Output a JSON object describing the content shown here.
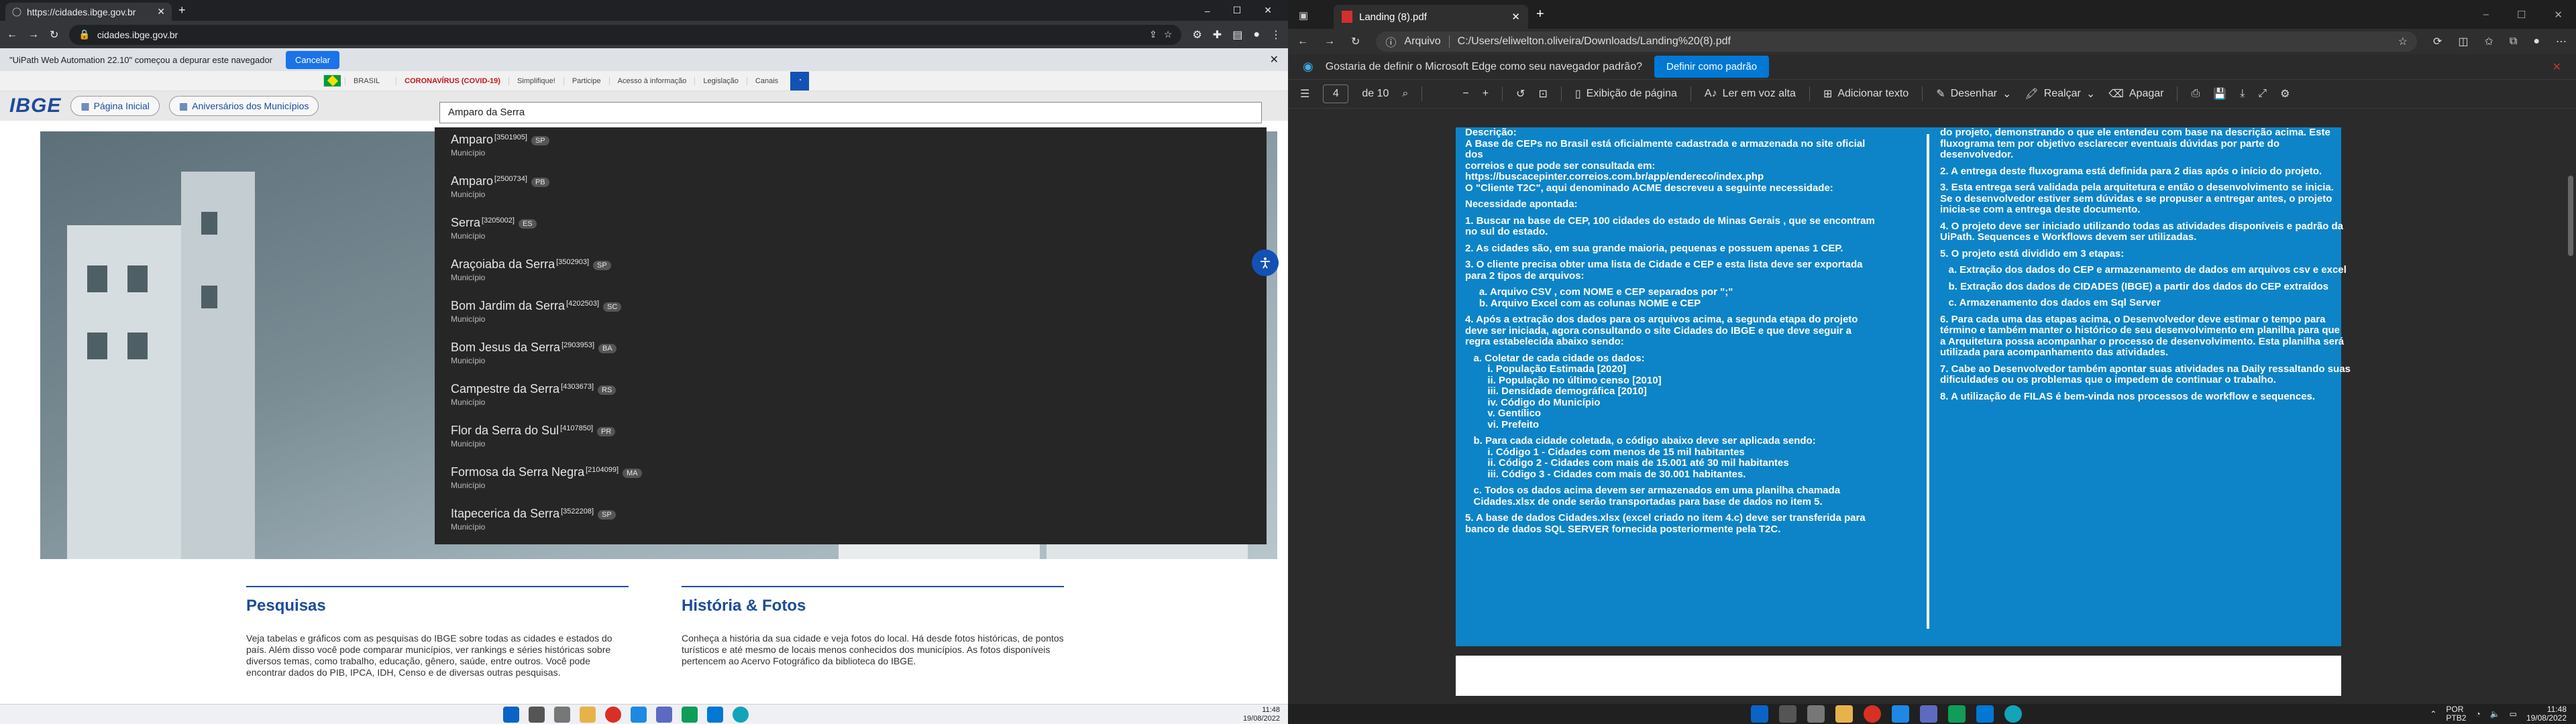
{
  "chrome": {
    "tab_title": "https://cidades.ibge.gov.br",
    "url": "cidades.ibge.gov.br",
    "automation_notice": "\"UiPath Web Automation 22.10\" começou a depurar este navegador",
    "cancel_label": "Cancelar"
  },
  "ibge": {
    "top_links": [
      "BRASIL",
      "CORONAVÍRUS (COVID-19)",
      "Simplifique!",
      "Participe",
      "Acesso à informação",
      "Legislação",
      "Canais"
    ],
    "logo": "IBGE",
    "nav": [
      "Página Inicial",
      "Aniversários dos Municípios"
    ],
    "search_value": "Amparo da Serra",
    "results": [
      {
        "name": "Amparo",
        "code": "[3501905]",
        "uf": "SP",
        "type": "Município"
      },
      {
        "name": "Amparo",
        "code": "[2500734]",
        "uf": "PB",
        "type": "Município"
      },
      {
        "name": "Serra",
        "code": "[3205002]",
        "uf": "ES",
        "type": "Município"
      },
      {
        "name": "Araçoiaba da Serra",
        "code": "[3502903]",
        "uf": "SP",
        "type": "Município"
      },
      {
        "name": "Bom Jardim da Serra",
        "code": "[4202503]",
        "uf": "SC",
        "type": "Município"
      },
      {
        "name": "Bom Jesus da Serra",
        "code": "[2903953]",
        "uf": "BA",
        "type": "Município"
      },
      {
        "name": "Campestre da Serra",
        "code": "[4303673]",
        "uf": "RS",
        "type": "Município"
      },
      {
        "name": "Flor da Serra do Sul",
        "code": "[4107850]",
        "uf": "PR",
        "type": "Município"
      },
      {
        "name": "Formosa da Serra Negra",
        "code": "[2104099]",
        "uf": "MA",
        "type": "Município"
      },
      {
        "name": "Itapecerica da Serra",
        "code": "[3522208]",
        "uf": "SP",
        "type": "Município"
      }
    ],
    "section1": {
      "title": "Pesquisas",
      "text": "Veja tabelas e gráficos com as pesquisas do IBGE sobre todas as cidades e estados do país. Além disso você pode comparar municípios, ver rankings e séries históricas sobre diversos temas, como trabalho, educação, gênero, saúde, entre outros. Você pode encontrar dados do PIB, IPCA, IDH, Censo e de diversas outras pesquisas."
    },
    "section2": {
      "title": "História & Fotos",
      "text": "Conheça a história da sua cidade e veja fotos do local. Há desde fotos históricas, de pontos turísticos e até mesmo de locais menos conhecidos dos municípios. As fotos disponíveis pertencem ao Acervo Fotográfico da biblioteca do IBGE."
    }
  },
  "left_clock": {
    "time": "11:48",
    "date": "19/08/2022"
  },
  "edge": {
    "tab_title": "Landing (8).pdf",
    "addr_label": "Arquivo",
    "path": "C:/Users/eliwelton.oliveira/Downloads/Landing%20(8).pdf",
    "default_prompt": "Gostaria de definir o Microsoft Edge como seu navegador padrão?",
    "default_btn": "Definir como padrão",
    "page_current": "4",
    "page_total": "de 10",
    "tools": [
      "Exibição de página",
      "Ler em voz alta",
      "Adicionar texto",
      "Desenhar",
      "Realçar",
      "Apagar"
    ]
  },
  "pdf": {
    "left_lines": [
      "Descrição:",
      "A Base de CEPs no Brasil está oficialmente cadastrada e armazenada no site oficial",
      "dos",
      "correios e que pode ser consultada em:",
      "https://buscacepinter.correios.com.br/app/endereco/index.php",
      "O \"Cliente T2C\", aqui denominado ACME descreveu a seguinte necessidade:",
      "",
      "Necessidade apontada:",
      "",
      "1. Buscar na base de CEP, 100 cidades do estado de Minas Gerais , que se encontram",
      "no sul do estado.",
      "",
      "2. As cidades são, em sua grande maioria, pequenas e possuem apenas 1 CEP.",
      "",
      "3. O cliente precisa obter uma lista de Cidade e CEP e esta lista deve ser exportada",
      "para 2 tipos de arquivos:",
      "",
      "     a. Arquivo CSV , com NOME e CEP separados por \";\"",
      "     b. Arquivo Excel com as colunas NOME e CEP",
      "",
      "4. Após a extração dos dados para os arquivos acima, a segunda etapa do projeto",
      "deve ser iniciada, agora consultando o site Cidades do IBGE e que deve seguir a",
      "regra estabelecida abaixo sendo:",
      "",
      "   a. Coletar de cada cidade os dados:",
      "        i. População Estimada [2020]",
      "        ii. População no último censo [2010]",
      "        iii. Densidade demográfica [2010]",
      "        iv. Código do Município",
      "        v. Gentílico",
      "        vi. Prefeito",
      "",
      "   b. Para cada cidade coletada, o código abaixo deve ser aplicada sendo:",
      "        i. Código 1 - Cidades com menos de 15 mil habitantes",
      "        ii. Código 2 - Cidades com mais de 15.001 até 30 mil habitantes",
      "        iii. Código 3 - Cidades com mais de 30.001 habitantes.",
      "",
      "   c. Todos os dados acima devem ser armazenados em uma planilha chamada",
      "   Cidades.xlsx de onde serão transportadas para base de dados no item 5.",
      "",
      "5. A base de dados Cidades.xlsx (excel criado no item 4.c) deve ser transferida para",
      "banco de dados SQL SERVER fornecida posteriormente pela T2C."
    ],
    "right_lines": [
      "do projeto, demonstrando o que ele entendeu com base na descrição acima. Este",
      "fluxograma tem por objetivo esclarecer eventuais dúvidas por parte do",
      "desenvolvedor.",
      "",
      "2. A entrega deste fluxograma está definida para 2 dias após o início do projeto.",
      "",
      "3. Esta entrega será validada pela arquitetura e então o desenvolvimento se inicia.",
      "Se o desenvolvedor estiver sem dúvidas e se propuser a entregar antes, o projeto",
      "inicia-se com a entrega deste documento.",
      "",
      "4. O projeto deve ser iniciado utilizando todas as atividades disponíveis e padrão da",
      "UiPath. Sequences e Workflows devem ser utilizadas.",
      "",
      "5. O projeto está dividido em 3 etapas:",
      "",
      "   a. Extração dos dados do CEP e armazenamento de dados em arquivos csv e excel",
      "",
      "   b. Extração dos dados de CIDADES (IBGE) a partir dos dados do CEP extraídos",
      "",
      "   c. Armazenamento dos dados em Sql Server",
      "",
      "6. Para cada uma das etapas acima, o Desenvolvedor deve estimar o tempo para",
      "término e também manter o histórico de seu desenvolvimento em planilha para que",
      "a Arquitetura possa acompanhar o processo de desenvolvimento. Esta planilha será",
      "utilizada para acompanhamento das atividades.",
      "",
      "7. Cabe ao Desenvolvedor também apontar suas atividades na Daily ressaltando suas",
      "dificuldades ou os problemas que o impedem de continuar o trabalho.",
      "",
      "8. A utilização de FILAS é bem-vinda nos processos de workflow e sequences."
    ]
  },
  "right_tray": {
    "lang1": "POR",
    "lang2": "PTB2",
    "time": "11:48",
    "date": "19/08/2022"
  }
}
